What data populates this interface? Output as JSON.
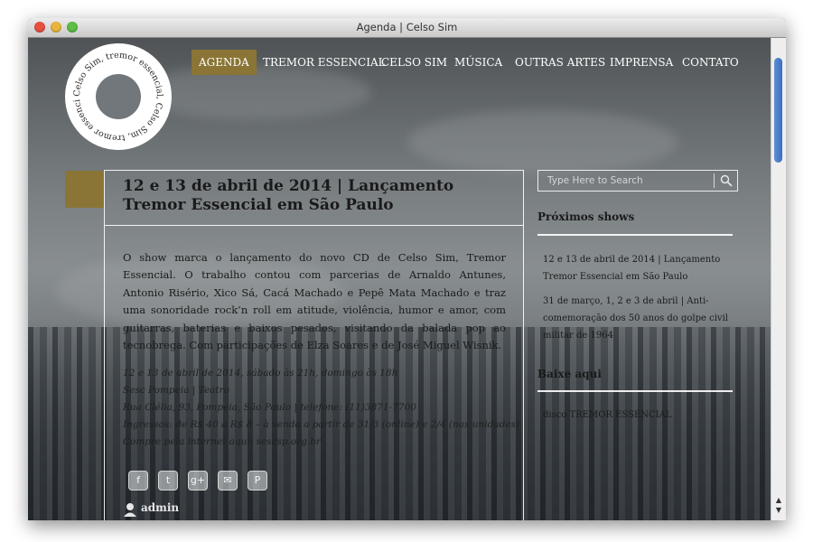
{
  "window": {
    "title": "Agenda | Celso Sim"
  },
  "logo": {
    "ring_text": "Celso Sim, tremor essencial, Celso Sim, tremor essencial,"
  },
  "nav": {
    "items": [
      "AGENDA",
      "TREMOR ESSENCIAL",
      "CELSO SIM",
      "MÚSICA",
      "OUTRAS ARTES",
      "IMPRENSA",
      "CONTATO"
    ],
    "active": "AGENDA"
  },
  "post": {
    "title": "12 e 13 de abril de 2014 | Lançamento Tremor Essencial em São Paulo",
    "body": "O show marca o lançamento do novo CD de Celso Sim, Tremor Essencial. O trabalho contou com parcerias de Arnaldo Antunes, Antonio Risério, Xico Sá, Cacá Machado e Pepê Mata Machado e traz uma sonoridade rock’n roll em atitude, violência, humor e amor, com guitarras, baterias e baixos pesados, visitando da balada pop ao tecnobrega. Com participações de Elza Soares e de José Miguel Wisnik.",
    "details": [
      "12 e 13 de abril de 2014, sábado às 21h, domingo às 18h",
      "Sesc Pompeia | Teatro",
      "Rua Clélia, 93, Pompeia, São Paulo | telefone: (11)3871-7700",
      "Ingressos: de R$ 40 a R$ 8 – à venda a partir de 31/3 (online) e 2/4 (nas unidades)",
      "Compre pela internet aqui: sescsp.org.br"
    ],
    "share": [
      {
        "icon": "facebook-icon",
        "glyph": "f"
      },
      {
        "icon": "twitter-icon",
        "glyph": "t"
      },
      {
        "icon": "google-plus-icon",
        "glyph": "g+"
      },
      {
        "icon": "email-icon",
        "glyph": "✉"
      },
      {
        "icon": "pinterest-icon",
        "glyph": "P"
      }
    ],
    "author": "admin"
  },
  "sidebar": {
    "search_placeholder": "Type Here to Search",
    "upcoming_title": "Próximos shows",
    "upcoming": [
      "12 e 13 de abril de 2014 | Lançamento Tremor Essencial em São Paulo",
      "31 de março, 1, 2 e 3 de abril | Anti-comemoração dos 50 anos do golpe civil militar de 1964"
    ],
    "download_title": "Baixe aqui",
    "download_item": "disco TREMOR ESSENCIAL"
  },
  "colors": {
    "accent": "#8a7536"
  }
}
